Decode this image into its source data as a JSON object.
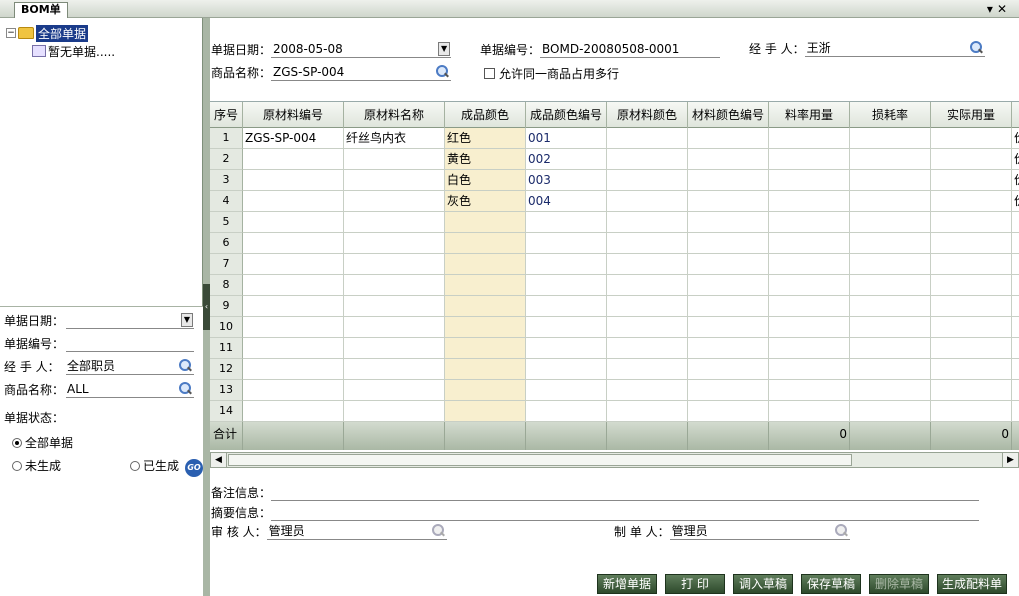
{
  "window": {
    "tab_title": "BOM单"
  },
  "tree": {
    "root": "全部单据",
    "child": "暂无单据....."
  },
  "left_filter": {
    "date_label": "单据日期：",
    "date_value": "",
    "number_label": "单据编号：",
    "number_value": "",
    "handler_label": "经 手 人：",
    "handler_value": "全部职员",
    "product_label": "商品名称：",
    "product_value": "ALL",
    "status_label": "单据状态：",
    "status_options": [
      "全部单据",
      "未生成",
      "已生成"
    ],
    "status_selected": "全部单据",
    "go_label": "GO"
  },
  "header": {
    "date_label": "单据日期：",
    "date_value": "2008-05-08",
    "number_label": "单据编号：",
    "number_value": "BOMD-20080508-0001",
    "handler_label": "经 手 人：",
    "handler_value": "王浙",
    "product_label": "商品名称：",
    "product_value": "ZGS-SP-004",
    "allow_label": "允许同一商品占用多行",
    "allow_checked": false
  },
  "grid": {
    "columns": [
      "序号",
      "原材料编号",
      "原材料名称",
      "成品颜色",
      "成品颜色编号",
      "原材料颜色",
      "材料颜色编号",
      "料率用量",
      "损耗率",
      "实际用量",
      ""
    ],
    "rows": [
      [
        "1",
        "ZGS-SP-004",
        "纤丝鸟内衣",
        "红色",
        "001",
        "",
        "",
        "",
        "",
        "",
        "价"
      ],
      [
        "2",
        "",
        "",
        "黄色",
        "002",
        "",
        "",
        "",
        "",
        "",
        "价"
      ],
      [
        "3",
        "",
        "",
        "白色",
        "003",
        "",
        "",
        "",
        "",
        "",
        "价"
      ],
      [
        "4",
        "",
        "",
        "灰色",
        "004",
        "",
        "",
        "",
        "",
        "",
        "价"
      ],
      [
        "5",
        "",
        "",
        "",
        "",
        "",
        "",
        "",
        "",
        "",
        ""
      ],
      [
        "6",
        "",
        "",
        "",
        "",
        "",
        "",
        "",
        "",
        "",
        ""
      ],
      [
        "7",
        "",
        "",
        "",
        "",
        "",
        "",
        "",
        "",
        "",
        ""
      ],
      [
        "8",
        "",
        "",
        "",
        "",
        "",
        "",
        "",
        "",
        "",
        ""
      ],
      [
        "9",
        "",
        "",
        "",
        "",
        "",
        "",
        "",
        "",
        "",
        ""
      ],
      [
        "10",
        "",
        "",
        "",
        "",
        "",
        "",
        "",
        "",
        "",
        ""
      ],
      [
        "11",
        "",
        "",
        "",
        "",
        "",
        "",
        "",
        "",
        "",
        ""
      ],
      [
        "12",
        "",
        "",
        "",
        "",
        "",
        "",
        "",
        "",
        "",
        ""
      ],
      [
        "13",
        "",
        "",
        "",
        "",
        "",
        "",
        "",
        "",
        "",
        ""
      ],
      [
        "14",
        "",
        "",
        "",
        "",
        "",
        "",
        "",
        "",
        "",
        ""
      ]
    ],
    "total": [
      "合计",
      "",
      "",
      "",
      "",
      "",
      "",
      "0",
      "",
      "0",
      ""
    ]
  },
  "footer": {
    "remark_label": "备注信息：",
    "remark_value": "",
    "summary_label": "摘要信息：",
    "summary_value": "",
    "reviewer_label": "审 核 人：",
    "reviewer_value": "管理员",
    "maker_label": "制 单 人：",
    "maker_value": "管理员"
  },
  "buttons": {
    "new": "新增单据",
    "print": "打 印",
    "load_draft": "调入草稿",
    "save_draft": "保存草稿",
    "delete_draft": "删除草稿",
    "generate": "生成配料单"
  },
  "colors": {
    "accent": "#2e4a2c",
    "highlight_column": "#f8efcf",
    "selection": "#1a3b8a"
  }
}
